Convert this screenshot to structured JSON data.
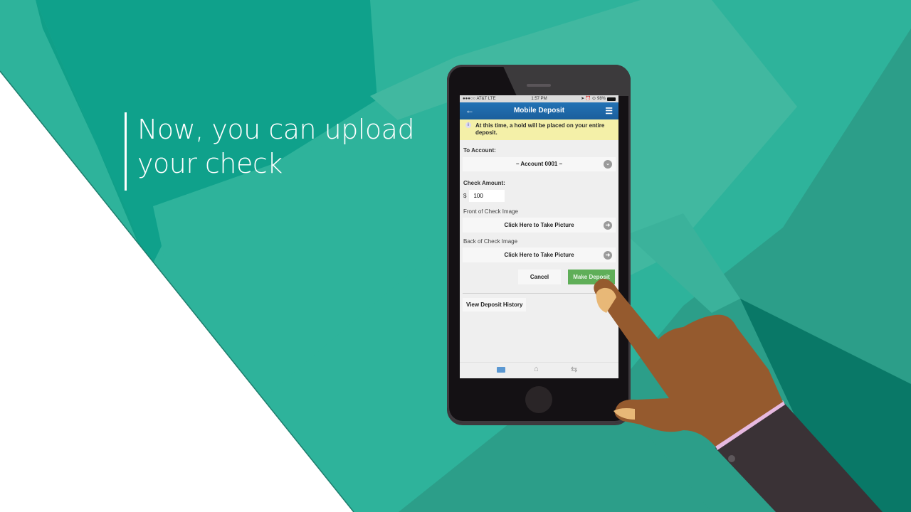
{
  "caption": {
    "line1": "Now, you can upload",
    "line2": "your check"
  },
  "colors": {
    "teal_base": "#2eb39b",
    "teal_dark": "#0fa18b",
    "teal_mid": "#2c9e89",
    "teal_deep": "#097867",
    "teal_light": "#41b8a0",
    "nav_blue": "#1f69a8",
    "notice_yellow": "#f4f0a8",
    "deposit_green": "#5fae58",
    "skin": "#955a2e",
    "nail": "#e8b877",
    "sleeve": "#3a3236",
    "cuff": "#e6b9e0"
  },
  "phone": {
    "statusbar": {
      "carrier": "●●●○○ AT&T  LTE",
      "time": "1:57 PM",
      "icons": "➤ ⏰ ⊙",
      "battery": "98%"
    },
    "navbar": {
      "back_icon": "←",
      "title": "Mobile Deposit",
      "menu_icon": "☰"
    },
    "notice": {
      "icon": "i",
      "text": "At this time, a hold will be placed on your entire deposit."
    },
    "to_account": {
      "label": "To Account:",
      "selected": "–      Account  0001      –",
      "chevron": "⌄"
    },
    "check_amount": {
      "label": "Check Amount:",
      "currency": "$",
      "value": "100"
    },
    "front_image": {
      "label": "Front of Check Image",
      "button": "Click Here to Take Picture",
      "arrow": "➜"
    },
    "back_image": {
      "label": "Back of Check Image",
      "button": "Click Here to Take Picture",
      "arrow": "➜"
    },
    "actions": {
      "cancel": "Cancel",
      "make_deposit": "Make Deposit"
    },
    "history": {
      "label": "View Deposit History"
    },
    "tabbar": {
      "home_icon": "⌂",
      "transfer_icon": "⇆"
    }
  }
}
